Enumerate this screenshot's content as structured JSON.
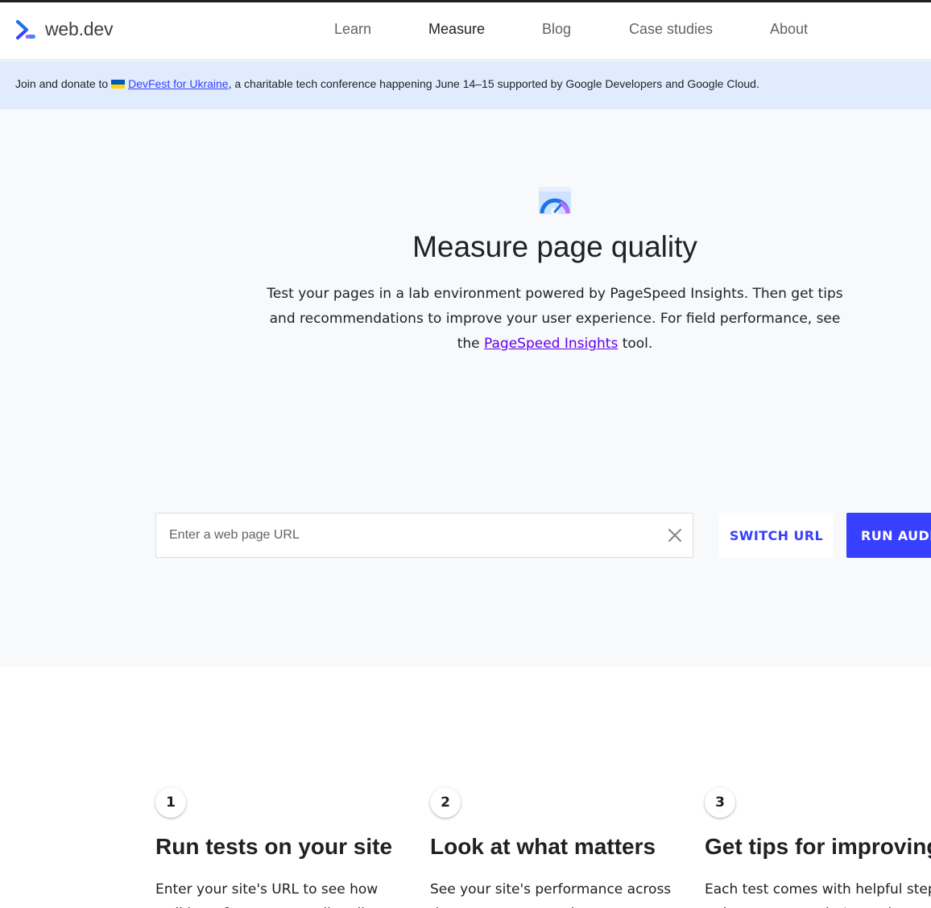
{
  "header": {
    "logo_text": "web.dev",
    "nav": [
      {
        "label": "Learn",
        "active": false
      },
      {
        "label": "Measure",
        "active": true
      },
      {
        "label": "Blog",
        "active": false
      },
      {
        "label": "Case studies",
        "active": false
      },
      {
        "label": "About",
        "active": false
      }
    ]
  },
  "banner": {
    "prefix": "Join and donate to ",
    "link_text": "DevFest for Ukraine",
    "suffix": ", a charitable tech conference happening June 14–15 supported by Google Developers and Google Cloud."
  },
  "hero": {
    "title": "Measure page quality",
    "description_before": "Test your pages in a lab environment powered by PageSpeed Insights. Then get tips and recommendations to improve your user experience. For field performance, see the ",
    "description_link": "PageSpeed Insights",
    "description_after": " tool.",
    "url_placeholder": "Enter a web page URL",
    "url_value": "",
    "switch_label": "SWITCH URL",
    "run_label": "RUN AUDIT"
  },
  "steps": [
    {
      "number": "1",
      "title": "Run tests on your site",
      "description": "Enter your site's URL to see how well it performs across all audits."
    },
    {
      "number": "2",
      "title": "Look at what matters",
      "description": "See your site's performance across the areas you care about most."
    },
    {
      "number": "3",
      "title": "Get tips for improving",
      "description": "Each test comes with helpful steps to improve your site's results."
    }
  ],
  "colors": {
    "accent": "#3740ff",
    "banner_bg": "#e0ecfe",
    "hero_bg": "#f8f9fa",
    "link_visited": "#6200ee"
  }
}
